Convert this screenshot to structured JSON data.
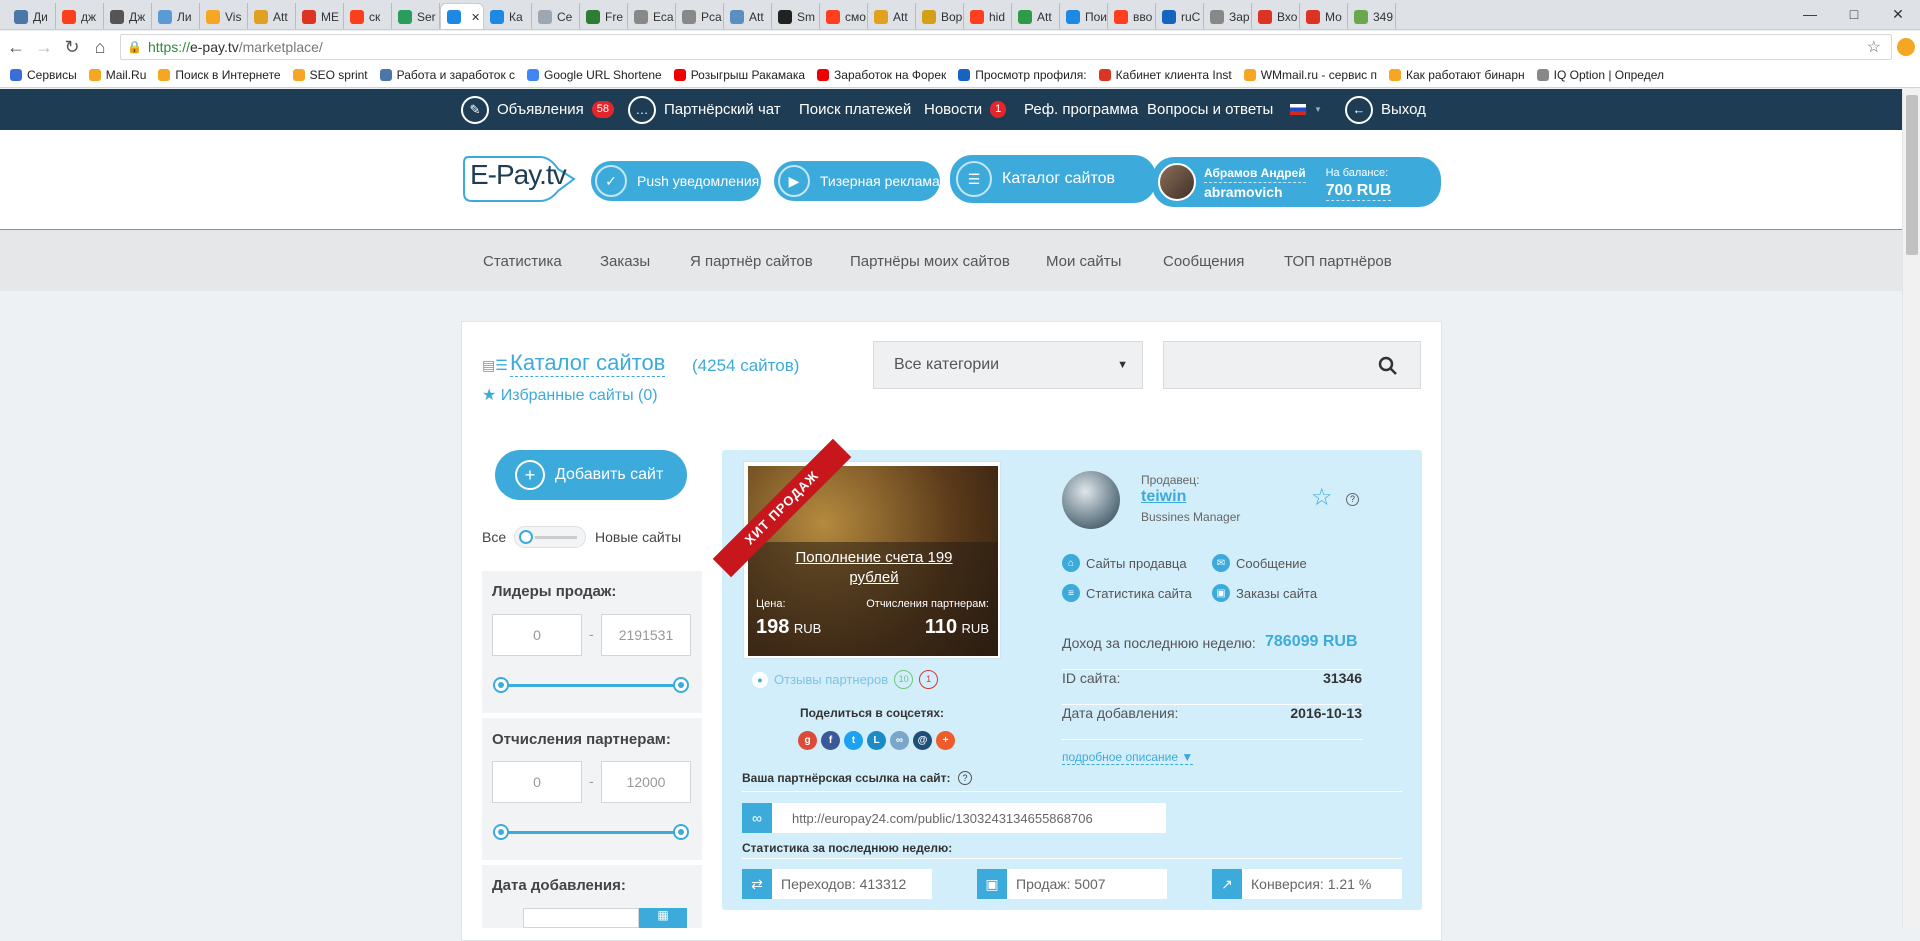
{
  "browser": {
    "tabs": [
      "Ди",
      "дж",
      "Дж",
      "Ли",
      "Vis",
      "Att",
      "МЕ",
      "ск",
      "Ser",
      "",
      "Ка",
      "Се",
      "Fre",
      "Еса",
      "Рса",
      "Att",
      "Sm",
      "смо",
      "Att",
      "Вор",
      "hid",
      "Att",
      "Пои",
      "вво",
      "ruC",
      "Зар",
      "Вхо",
      "Мо",
      "349"
    ],
    "url_prefix": "https://",
    "url_host": "e-pay.tv",
    "url_path": "/marketplace/",
    "bookmarks": [
      "Сервисы",
      "Mail.Ru",
      "Поиск в Интернете",
      "SEO sprint",
      "Работа и заработок с",
      "Google URL Shortene",
      "Розыгрыш Ракамака",
      "Заработок на Форек",
      "Просмотр профиля:",
      "Кабинет клиента Inst",
      "WMmail.ru - сервис п",
      "Как работают бинарн",
      "IQ Option | Определ"
    ]
  },
  "topnav": {
    "ads": "Объявления",
    "ads_count": "58",
    "chat": "Партнёрский чат",
    "payments": "Поиск платежей",
    "news": "Новости",
    "news_count": "1",
    "ref": "Реф. программа",
    "faq": "Вопросы и ответы",
    "logout": "Выход"
  },
  "header": {
    "logo": "E-Pay.tv",
    "push": "Push уведомления",
    "teaser": "Тизерная реклама",
    "catalog": "Каталог сайтов",
    "user_name": "Абрамов Андрей",
    "user_login": "abramovich",
    "balance_label": "На балансе:",
    "balance": "700 RUB"
  },
  "subnav": [
    "Статистика",
    "Заказы",
    "Я партнёр сайтов",
    "Партнёры моих сайтов",
    "Мои сайты",
    "Сообщения",
    "ТОП партнёров"
  ],
  "catalog": {
    "title": "Каталог сайтов",
    "count": "(4254 сайтов)",
    "favorites": "Избранные сайты (0)",
    "category": "Все категории"
  },
  "sidebar": {
    "add_site": "Добавить сайт",
    "toggle_all": "Все",
    "toggle_new": "Новые сайты",
    "leaders_label": "Лидеры продаж:",
    "leaders_min": "0",
    "leaders_max": "2191531",
    "partners_label": "Отчисления партнерам:",
    "partners_min": "0",
    "partners_max": "12000",
    "date_label": "Дата добавления:"
  },
  "card": {
    "ribbon": "ХИТ ПРОДАЖ",
    "product_title": "Пополнение счета 199 рублей",
    "price_label": "Цена:",
    "price_value": "198",
    "price_currency": "RUB",
    "partner_label": "Отчисления партнерам:",
    "partner_value": "110",
    "partner_currency": "RUB",
    "reviews": "Отзывы партнеров",
    "reviews_good": "10",
    "reviews_bad": "1",
    "share_label": "Поделиться в соцсетях:",
    "seller_label": "Продавец:",
    "seller_name": "teiwin",
    "seller_role": "Bussines Manager",
    "help": "?",
    "link_seller_sites": "Сайты продавца",
    "link_message": "Сообщение",
    "link_stats": "Статистика сайта",
    "link_orders": "Заказы сайта",
    "income_label": "Доход за последнюю неделю:",
    "income_value": "786099 RUB",
    "id_label": "ID сайта:",
    "id_value": "31346",
    "date_label": "Дата добавления:",
    "date_value": "2016-10-13",
    "more": "подробное описание ▼",
    "partner_link_label": "Ваша партнёрская ссылка на сайт:",
    "partner_link": "http://europay24.com/public/1303243134655868706",
    "stats_label": "Статистика за последнюю неделю:",
    "stat_clicks": "Переходов: 413312",
    "stat_sales": "Продаж: 5007",
    "stat_conv": "Конверсия: 1.21 %"
  }
}
